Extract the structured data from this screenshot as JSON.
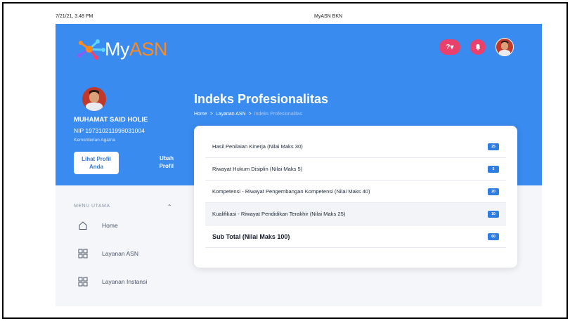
{
  "print_header": {
    "datetime": "7/21/21, 3.48 PM",
    "title": "MyASN BKN"
  },
  "brand": {
    "logo_my": "My",
    "logo_asn": "ASN"
  },
  "topbar": {
    "help_icon": "question-icon",
    "bell_icon": "bell-icon",
    "avatar": "user-avatar"
  },
  "profile": {
    "name": "MUHAMAT SAID HOLIE",
    "nip": "NIP 197310211998031004",
    "office": "Kementerian Agama",
    "view_button_line1": "Lihat Profil",
    "view_button_line2": "Anda",
    "edit_button_line1": "Ubah",
    "edit_button_line2": "Profil"
  },
  "page": {
    "title": "Indeks Profesionalitas",
    "breadcrumb": [
      "Home",
      "Layanan ASN",
      "Indeks Profesionalitas"
    ],
    "breadcrumb_sep": ">"
  },
  "menu": {
    "heading": "MENU UTAMA",
    "items": [
      {
        "label": "Home",
        "icon": "home-icon"
      },
      {
        "label": "Layanan ASN",
        "icon": "grid-icon"
      },
      {
        "label": "Layanan Instansi",
        "icon": "grid-icon"
      }
    ]
  },
  "scores": {
    "rows": [
      {
        "label": "Hasil Penilaian Kinerja (Nilai Maks 30)",
        "value": "25"
      },
      {
        "label": "Riwayat Hukum Disiplin (Nilai Maks 5)",
        "value": "5"
      },
      {
        "label": "Kompetensi - Riwayat Pengembangan Kompetensi (Nilai Maks 40)",
        "value": "20"
      },
      {
        "label": "Kualifikasi - Riwayat Pendidikan Terakhir (Nilai Maks 25)",
        "value": "10"
      }
    ],
    "subtotal_label": "Sub Total (Nilai Maks 100)",
    "subtotal_value": "60"
  },
  "colors": {
    "primary": "#3a8bef",
    "accent": "#e9416b",
    "badge": "#2f7de1",
    "brand_orange": "#ff8a1a"
  }
}
